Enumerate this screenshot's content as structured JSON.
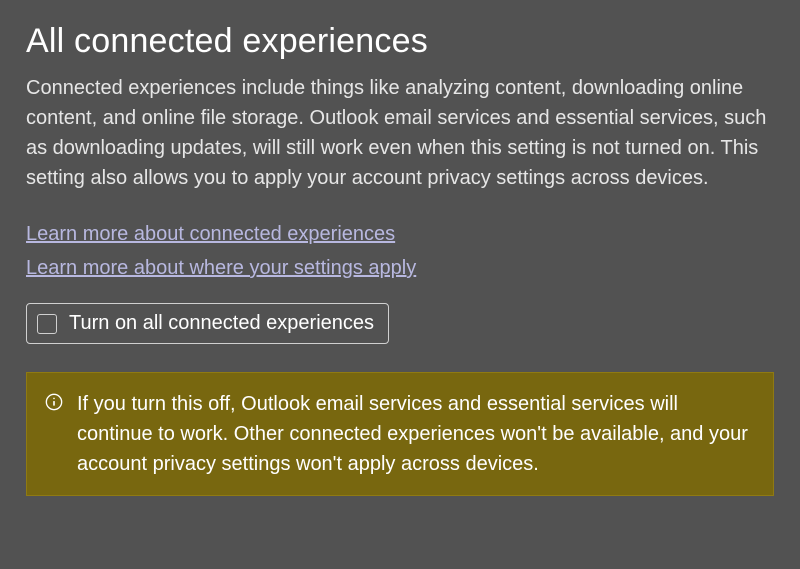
{
  "section": {
    "title": "All connected experiences",
    "description": "Connected experiences include things like analyzing content, downloading online content, and online file storage. Outlook email services and essential services, such as downloading updates, will still work even when this setting is not turned on. This setting also allows you to apply your account privacy settings across devices."
  },
  "links": {
    "learn_experiences": "Learn more about connected experiences",
    "learn_settings": "Learn more about where your settings apply"
  },
  "checkbox": {
    "label": "Turn on all connected experiences"
  },
  "info": {
    "text": "If you turn this off, Outlook email services and essential services will continue to work. Other connected experiences won't be available, and your account privacy settings won't apply across devices."
  }
}
